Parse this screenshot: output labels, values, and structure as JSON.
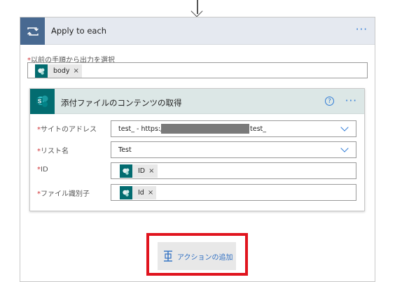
{
  "loop": {
    "title": "Apply to each",
    "more_label": "···",
    "output_field": {
      "required_mark": "*",
      "label": "以前の手順から出力を選択",
      "token": "body",
      "remove": "×"
    }
  },
  "action": {
    "title": "添付ファイルのコンテンツの取得",
    "help_label": "?",
    "more_label": "···",
    "fields": [
      {
        "required_mark": "*",
        "label": "サイトのアドレス",
        "value_prefix": "test_ - https://",
        "value_suffix": "test_"
      },
      {
        "required_mark": "*",
        "label": "リスト名",
        "value": "Test"
      },
      {
        "required_mark": "*",
        "label": "ID",
        "token": "ID",
        "remove": "×"
      },
      {
        "required_mark": "*",
        "label": "ファイル識別子",
        "token": "Id",
        "remove": "×"
      }
    ]
  },
  "add_action": {
    "label": "アクションの追加"
  },
  "colors": {
    "loop_accent": "#486991",
    "sharepoint_accent": "#036c70",
    "link_blue": "#2f7bd6",
    "highlight_red": "#e0141e"
  },
  "icons": [
    "arrow-down-icon",
    "loop-icon",
    "more-icon",
    "sharepoint-icon",
    "help-icon",
    "chevron-down-icon",
    "close-icon",
    "add-step-icon"
  ]
}
